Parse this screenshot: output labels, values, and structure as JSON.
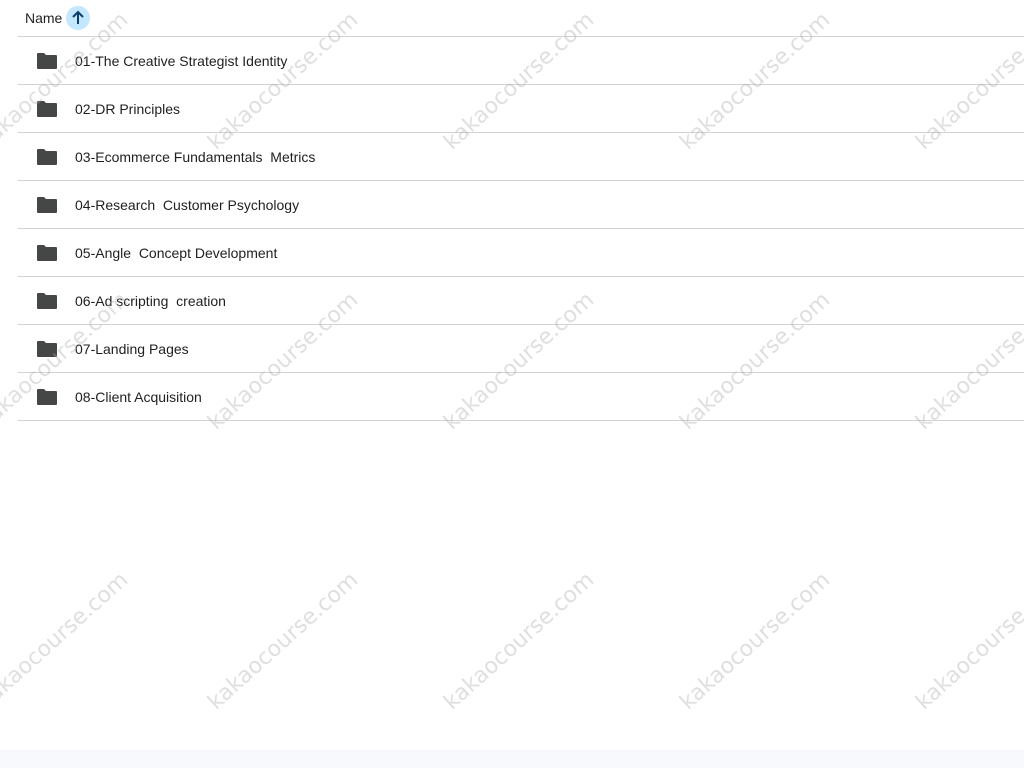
{
  "header": {
    "name_label": "Name",
    "sort_direction": "ascending",
    "sort_icon": "arrow-up-icon",
    "sort_color": "#c2e7ff"
  },
  "files": [
    {
      "name": "01-The Creative Strategist Identity",
      "type": "folder"
    },
    {
      "name": "02-DR Principles",
      "type": "folder"
    },
    {
      "name": "03-Ecommerce Fundamentals  Metrics",
      "type": "folder"
    },
    {
      "name": "04-Research  Customer Psychology",
      "type": "folder"
    },
    {
      "name": "05-Angle  Concept Development",
      "type": "folder"
    },
    {
      "name": "06-Ad scripting  creation",
      "type": "folder"
    },
    {
      "name": "07-Landing Pages",
      "type": "folder"
    },
    {
      "name": "08-Client Acquisition",
      "type": "folder"
    }
  ],
  "watermark": {
    "text": "kakaocourse.com"
  }
}
